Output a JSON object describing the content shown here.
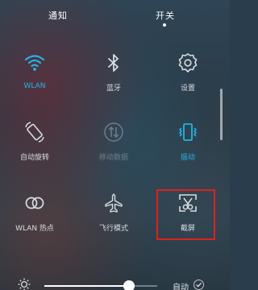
{
  "header": {
    "tabs": [
      {
        "label": "通知",
        "selected": false
      },
      {
        "label": "开关",
        "selected": true
      }
    ]
  },
  "toggles": [
    {
      "label": "WLAN",
      "icon": "wifi-icon",
      "state": "on"
    },
    {
      "label": "蓝牙",
      "icon": "bluetooth-icon",
      "state": "off"
    },
    {
      "label": "设置",
      "icon": "gear-icon",
      "state": "off"
    },
    {
      "label": "自动旋转",
      "icon": "auto-rotate-icon",
      "state": "off"
    },
    {
      "label": "移动数据",
      "icon": "mobile-data-icon",
      "state": "disabled"
    },
    {
      "label": "振动",
      "icon": "vibrate-icon",
      "state": "on"
    },
    {
      "label": "WLAN 热点",
      "icon": "hotspot-icon",
      "state": "off"
    },
    {
      "label": "飞行模式",
      "icon": "airplane-icon",
      "state": "off"
    },
    {
      "label": "截屏",
      "icon": "screenshot-icon",
      "state": "off",
      "highlighted": true
    }
  ],
  "brightness": {
    "level": 0.75,
    "auto_label": "自动",
    "auto_checked": true
  },
  "colors": {
    "active": "#25b3e6",
    "inactive": "#d7dde2",
    "disabled": "#6e7e89",
    "highlight_border": "#e02020"
  }
}
